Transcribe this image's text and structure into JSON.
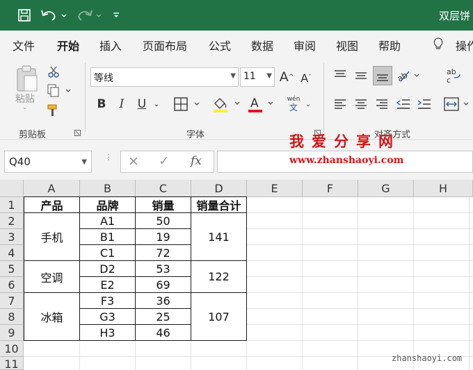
{
  "window": {
    "title": "双层饼"
  },
  "menu": {
    "tabs": [
      "文件",
      "开始",
      "插入",
      "页面布局",
      "公式",
      "数据",
      "审阅",
      "视图",
      "帮助"
    ],
    "active": "开始",
    "tell_me": "操作"
  },
  "ribbon": {
    "clipboard": {
      "paste_label": "粘贴",
      "group_label": "剪贴板"
    },
    "font": {
      "name": "等线",
      "size": "11",
      "group_label": "字体",
      "bold": "B",
      "italic": "I",
      "underline": "U",
      "phonetic_top": "wén",
      "phonetic_bottom": "文"
    },
    "alignment": {
      "group_label": "对齐方式"
    },
    "colors": {
      "font_color": "#e81123",
      "fill_color": "#ffeb3b"
    }
  },
  "formula_bar": {
    "name_box": "Q40",
    "fx": "fx",
    "formula": ""
  },
  "watermark": {
    "cn": "我爱分享网",
    "url": "www.zhanshaoyi.com",
    "bottom": "zhanshaoyi.com"
  },
  "sheet": {
    "columns": [
      "A",
      "B",
      "C",
      "D",
      "E",
      "F",
      "G",
      "H"
    ],
    "rows": [
      "1",
      "2",
      "3",
      "4",
      "5",
      "6",
      "7",
      "8",
      "9",
      "10",
      "11"
    ],
    "headers": [
      "产品",
      "品牌",
      "销量",
      "销量合计"
    ],
    "products": [
      "手机",
      "空调",
      "冰箱"
    ],
    "brands": [
      "A1",
      "B1",
      "C1",
      "D2",
      "E2",
      "F3",
      "G3",
      "H3"
    ],
    "sales": [
      "50",
      "19",
      "72",
      "53",
      "69",
      "36",
      "25",
      "46"
    ],
    "totals": [
      "141",
      "122",
      "107"
    ]
  }
}
